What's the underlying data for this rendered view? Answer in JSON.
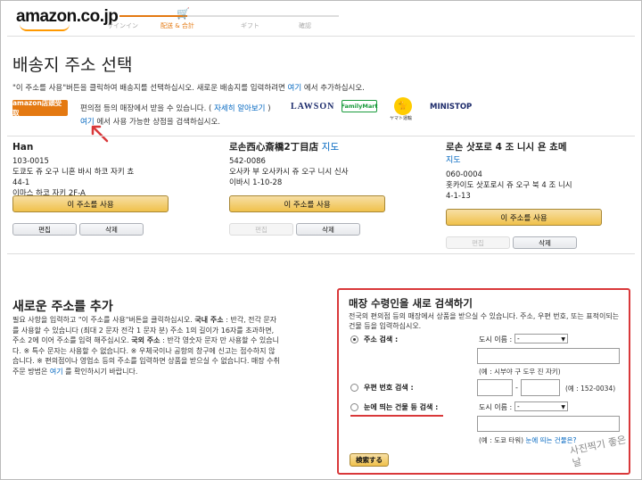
{
  "header": {
    "logo": "amazon.co.jp",
    "steps": [
      {
        "label": "サインイン"
      },
      {
        "label": "配送 & 合計"
      },
      {
        "label": "ギフト"
      },
      {
        "label": "確認"
      }
    ]
  },
  "page": {
    "title": "배송지 주소 선택",
    "intro_prefix": "\"이 주소를 사용\"버튼을 클릭하여 배송지를 선택하십시오. 새로운 배송지를 입력하려면 ",
    "intro_link": "여기",
    "intro_suffix": " 에서 추가하십시오."
  },
  "stores": {
    "amazon_badge": "amazon店頭受取",
    "text_prefix": "편의점 등의 매장에서 받을 수 있습니다. ( ",
    "text_link": "자세히 알아보기",
    "text_suffix": " )",
    "lawson": "LAWSON",
    "familymart": "FamilyMart",
    "yamato_label": "ヤマト運輸",
    "ministop": "MINISTOP",
    "search_link": "여기",
    "search_suffix": " 에서 사용 가능한 상점을 검색하십시오."
  },
  "addresses": [
    {
      "name": "Han",
      "name_link": "",
      "postal": "103-0015",
      "lines": [
        "도쿄도 쥬 오구 니혼 바시 하코 자키 쵸",
        "44-1",
        "이마스 하코 자키 2F-A"
      ],
      "use_label": "이 주소를 사용",
      "edit_label": "편집",
      "delete_label": "삭제",
      "edit_disabled": false
    },
    {
      "name": "로손西心斎橋2丁目店",
      "name_link": "지도",
      "postal": "542-0086",
      "lines": [
        "오사카 부 오사카시 쥬 오구 니시 신사",
        "이바시 1-10-28"
      ],
      "use_label": "이 주소를 사용",
      "edit_label": "편집",
      "delete_label": "삭제",
      "edit_disabled": true
    },
    {
      "name": "로손 삿포로 4 조 니시 욘 쵸메",
      "name_link": "지도",
      "postal": "060-0004",
      "lines": [
        "홋카이도 삿포로시 쥬 오구 북 4 조 니시",
        "4-1-13"
      ],
      "use_label": "이 주소를 사용",
      "edit_label": "편집",
      "delete_label": "삭제",
      "edit_disabled": true
    }
  ],
  "new_address": {
    "title": "새로운 주소를 추가",
    "p1": "필요 사항을 입력하고 \"이 주소를 사용\"버튼을 클릭하십시오. ",
    "p1_bold": "국내 주소",
    "p1b": " : 반각, 전각 문자를 사용할 수 있습니다 (최대 2 문자 전각 1 문자 분) 주소 1의 길이가 16자를 초과하면, 주소 2에 이어 주소를 입력 해주십시오. ",
    "p1_bold2": "국외 주소",
    "p1c": " : 반각 영숫자 문자 만 사용할 수 있습니다. ※ 특수 문자는 사용할 수 없습니다. ※ 우체국이나 공항의 창구에 신고는 접수하지 않습니다. ※ 편의점이나 영업소 등의 주소를 입력하면 상품을 받으실 수 없습니다. 매장 수취 주문 방법은 ",
    "p1_link": "여기",
    "p1d": " 를 확인하시기 바랍니다."
  },
  "store_search": {
    "title": "매장 수령인을 새로 검색하기",
    "desc": "전국의 편의점 등의 매장에서 상품을 받으실 수 있습니다. 주소, 우편 번호, 또는 표적이되는 건물 등을 입력하십시오.",
    "options": [
      {
        "label": "주소 검색 :",
        "checked": true
      },
      {
        "label": "우편 번호 검색 :",
        "checked": false
      },
      {
        "label": "눈에 띄는 건물 등 검색 :",
        "checked": false
      }
    ],
    "city_label": "도시 이름 :",
    "city_select": "-",
    "city_label2": "도시 이름 :",
    "city_select2": "-",
    "address_hint": "(예 : 시부야 구 도우 진 자키)",
    "zip_sep": "-",
    "zip_hint": "(예 : 152-0034)",
    "landmark_hint_prefix": "(예 : 도쿄 타워) ",
    "landmark_hint_link": "눈에 띄는 건물은?",
    "search_button": "検索する"
  },
  "watermark": "사진찍기 좋은날",
  "colors": {
    "accent_orange": "#e47911",
    "link_blue": "#0066c0",
    "highlight_red": "#d9383a",
    "button_yellow": "#f0c14b"
  }
}
